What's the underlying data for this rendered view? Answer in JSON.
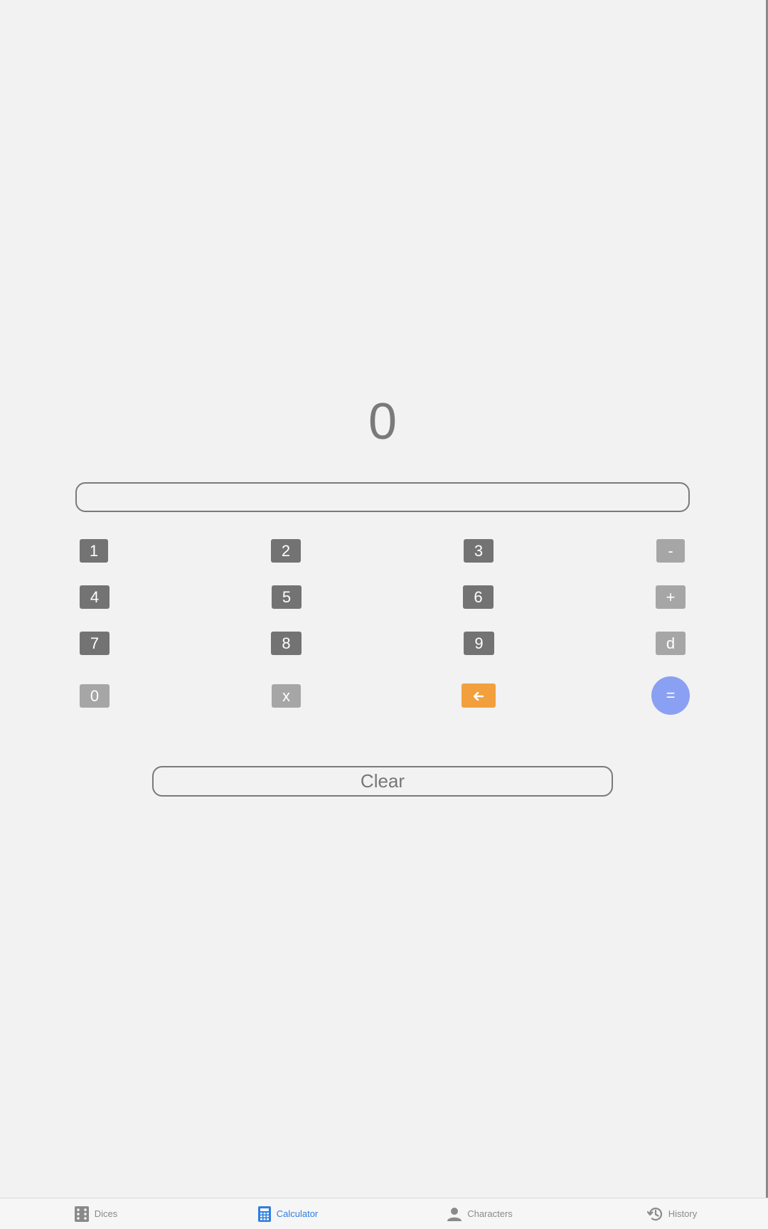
{
  "display": {
    "value": "0"
  },
  "expression": {
    "value": "",
    "placeholder": ""
  },
  "keypad": {
    "k1": "1",
    "k2": "2",
    "k3": "3",
    "minus": "-",
    "k4": "4",
    "k5": "5",
    "k6": "6",
    "plus": "+",
    "k7": "7",
    "k8": "8",
    "k9": "9",
    "dice": "d",
    "k0": "0",
    "times": "x",
    "backspace_icon": "arrow-left-icon",
    "equals": "="
  },
  "clear_label": "Clear",
  "tabbar": {
    "tabs": [
      {
        "label": "Dices",
        "icon": "dice-icon",
        "active": false
      },
      {
        "label": "Calculator",
        "icon": "calculator-icon",
        "active": true
      },
      {
        "label": "Characters",
        "icon": "person-icon",
        "active": false
      },
      {
        "label": "History",
        "icon": "history-icon",
        "active": false
      }
    ]
  },
  "colors": {
    "background": "#f2f2f2",
    "number_key": "#737373",
    "operator_key": "#a6a6a6",
    "backspace_key": "#f2a03d",
    "equals_key": "#8aa0f2",
    "active_tab": "#2f7ee0",
    "inactive_tab": "#8a8a8a"
  }
}
